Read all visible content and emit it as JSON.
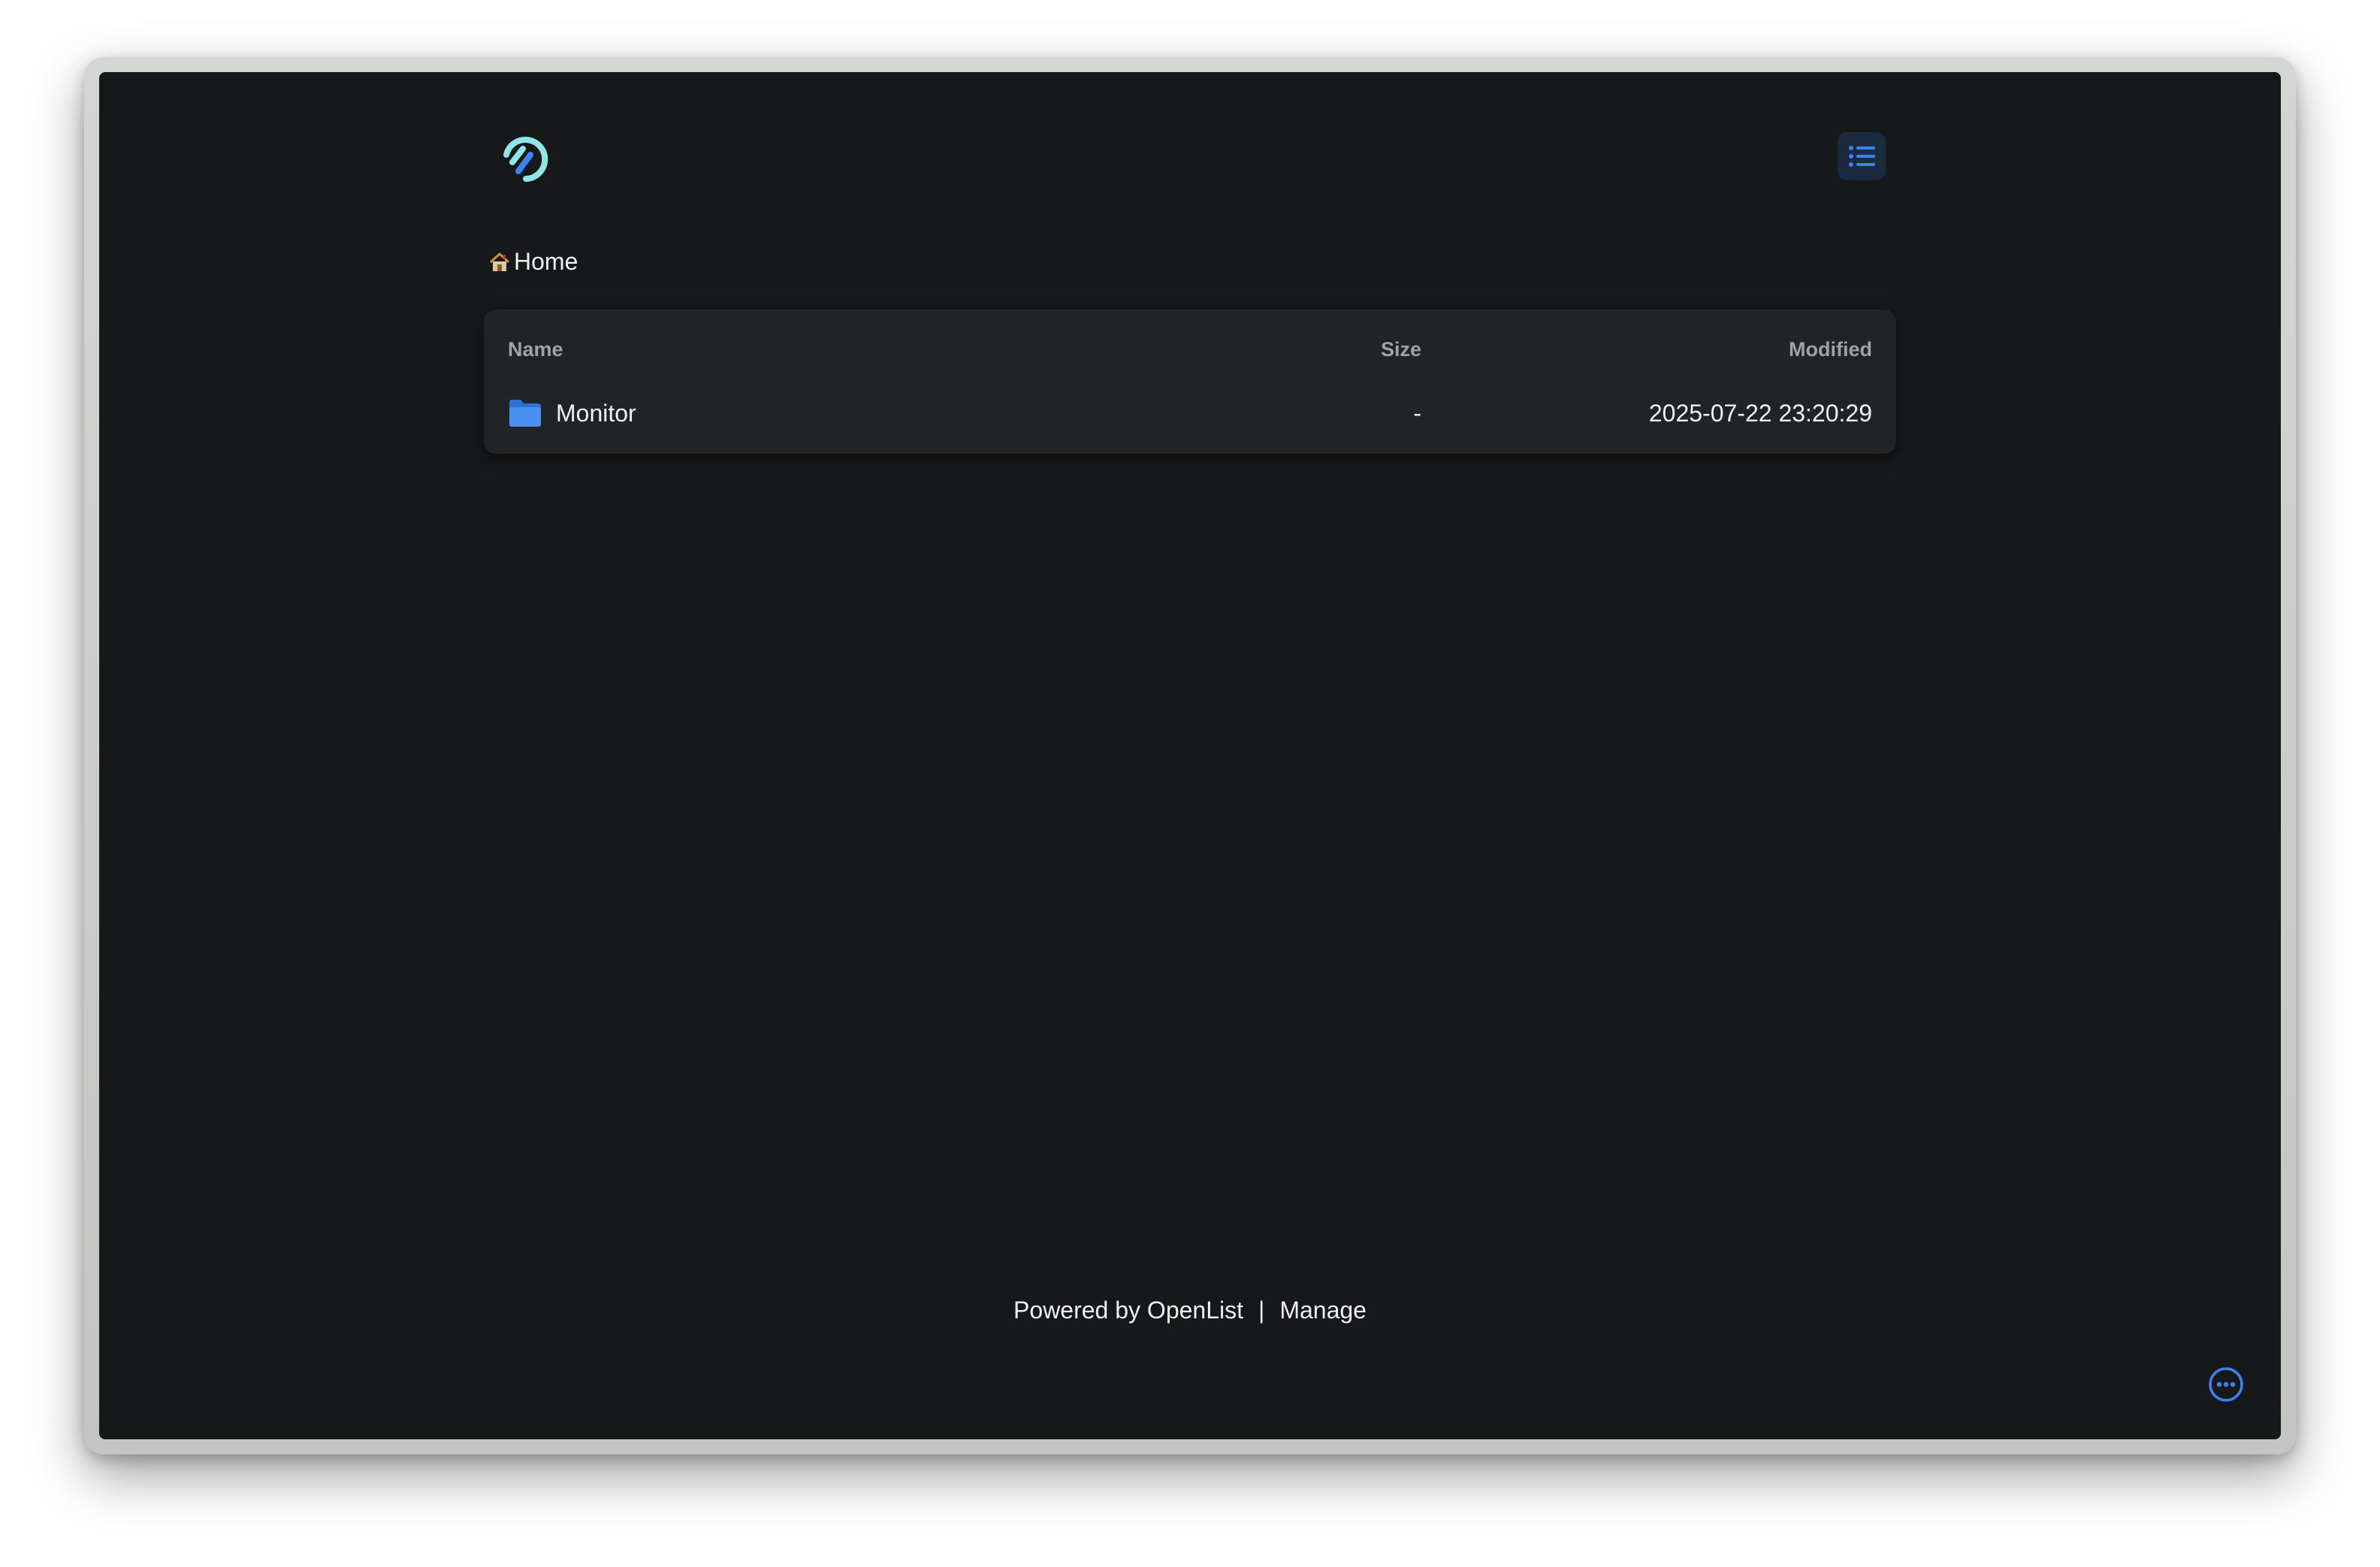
{
  "header": {
    "logo_icon": "openlist-logo-icon",
    "list_view_icon": "list-icon"
  },
  "breadcrumb": {
    "home_icon": "house-icon",
    "home_label": "Home"
  },
  "file_table": {
    "columns": {
      "name": "Name",
      "size": "Size",
      "modified": "Modified"
    },
    "rows": [
      {
        "icon": "folder-icon",
        "name": "Monitor",
        "size": "-",
        "modified": "2025-07-22 23:20:29"
      }
    ]
  },
  "footer": {
    "powered_by": "Powered by OpenList",
    "separator": "|",
    "manage": "Manage"
  },
  "floating": {
    "more_icon": "more-horizontal-icon"
  },
  "colors": {
    "background": "#17181a",
    "card": "#212426",
    "accent_blue": "#3b82f6",
    "logo_teal": "#8ee6e6"
  }
}
